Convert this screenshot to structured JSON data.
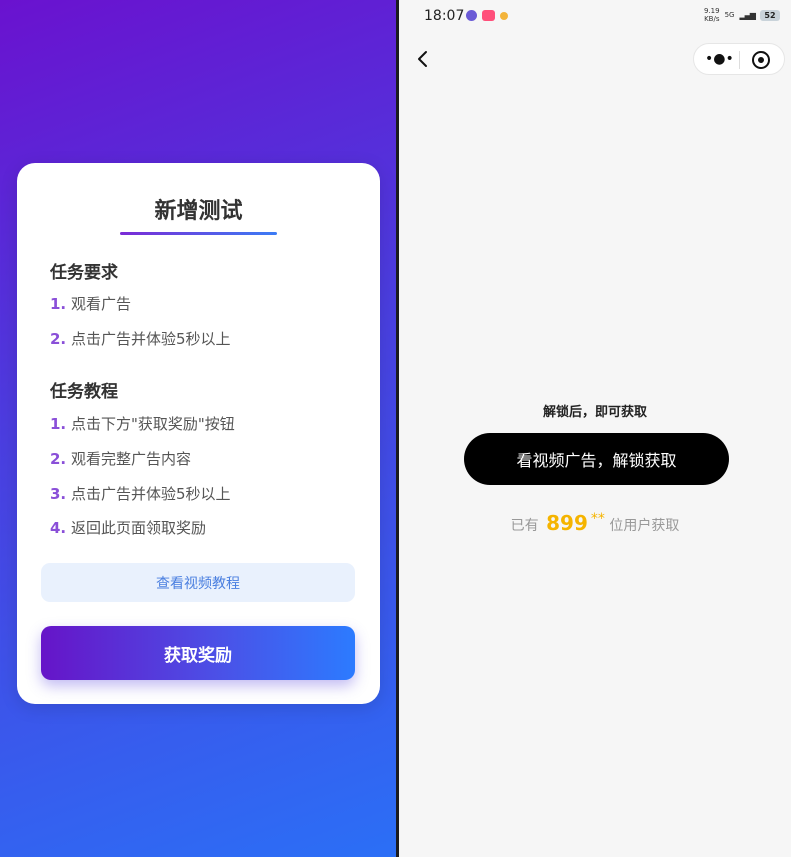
{
  "left": {
    "card_title": "新增测试",
    "requirements": {
      "title": "任务要求",
      "items": [
        {
          "num": "1.",
          "text": "观看广告"
        },
        {
          "num": "2.",
          "text": "点击广告并体验5秒以上"
        }
      ]
    },
    "tutorial": {
      "title": "任务教程",
      "items": [
        {
          "num": "1.",
          "text": "点击下方\"获取奖励\"按钮"
        },
        {
          "num": "2.",
          "text": "观看完整广告内容"
        },
        {
          "num": "3.",
          "text": "点击广告并体验5秒以上"
        },
        {
          "num": "4.",
          "text": "返回此页面领取奖励"
        }
      ]
    },
    "video_tutorial_label": "查看视频教程",
    "get_reward_label": "获取奖励"
  },
  "right": {
    "status_bar": {
      "time": "18:07",
      "net_speed_value": "9.19",
      "net_speed_unit": "KB/s",
      "network": "5G",
      "battery": "52"
    },
    "unlock_hint": "解锁后，即可获取",
    "unlock_button": "看视频广告，解锁获取",
    "user_count": {
      "prefix": "已有",
      "count": "899",
      "stars": "**",
      "suffix": "位用户获取"
    }
  },
  "colors": {
    "left_gradient_start": "#6a12cf",
    "left_gradient_end": "#2b6ff6",
    "step_number": "#8a4fd8",
    "count_highlight": "#f5b400"
  },
  "icons": [
    "back-arrow-icon",
    "more-dots-icon",
    "target-icon"
  ]
}
